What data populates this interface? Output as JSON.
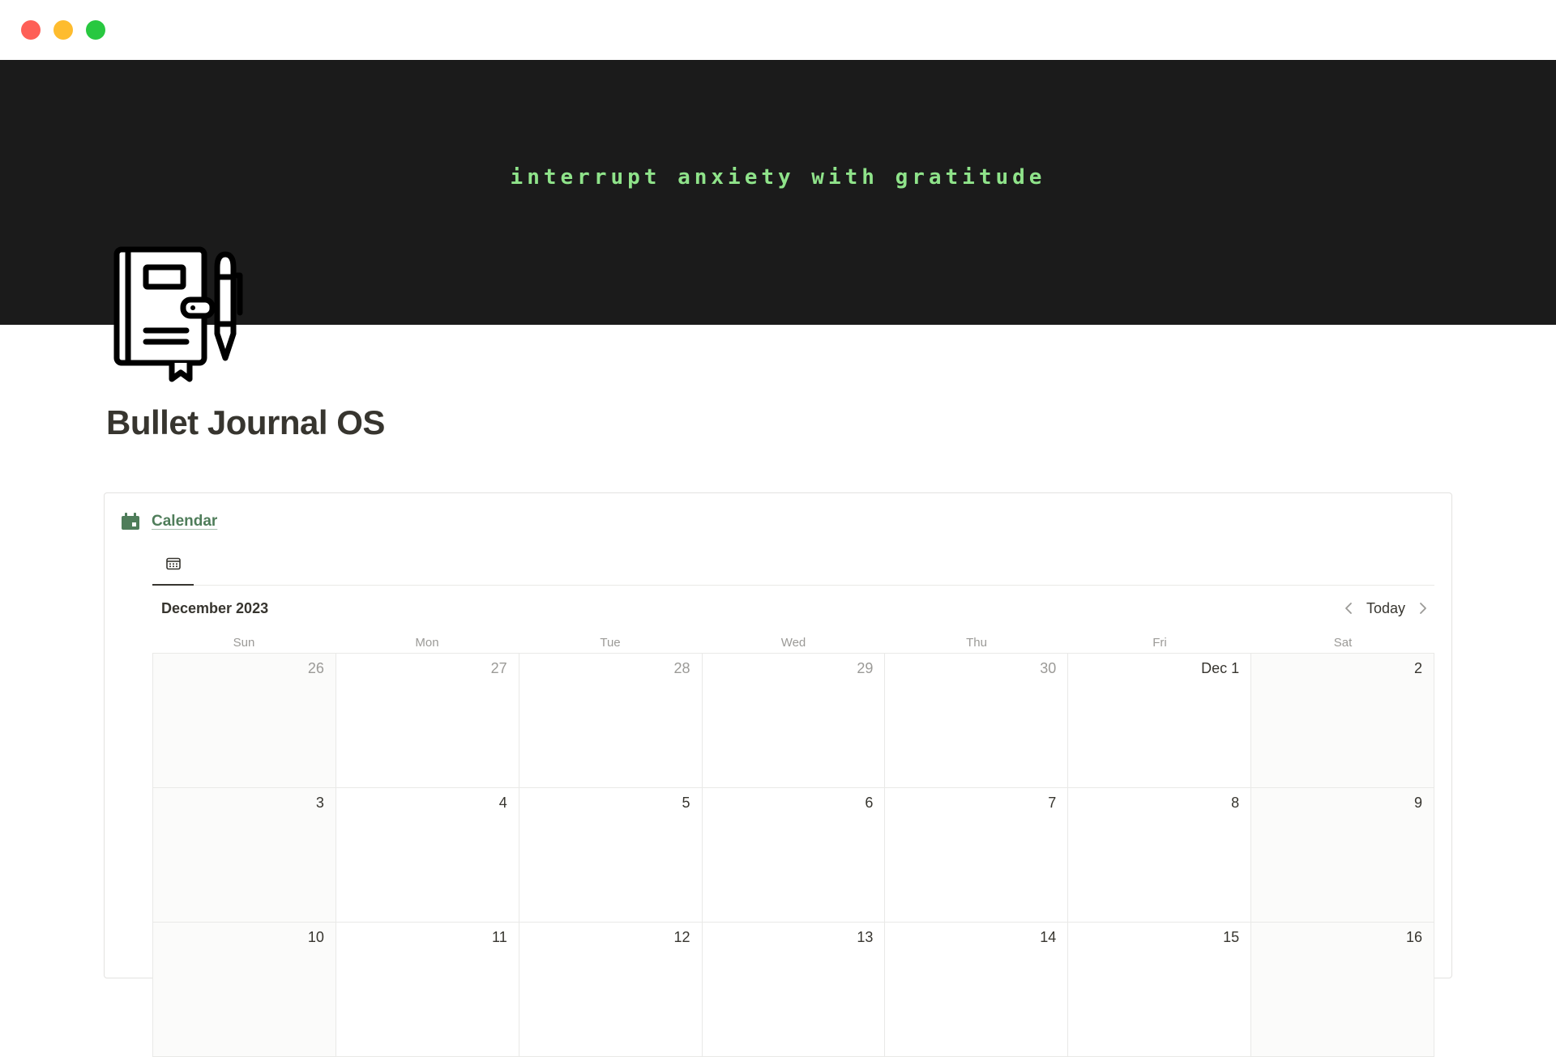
{
  "window": {
    "controls": [
      "close",
      "minimize",
      "maximize"
    ]
  },
  "cover": {
    "text": "interrupt anxiety with gratitude",
    "background_color": "#1b1b1b",
    "text_color": "#8fe38a"
  },
  "page": {
    "icon": "bullet-journal-notebook-pen-icon",
    "title": "Bullet Journal OS"
  },
  "calendar": {
    "db_icon": "calendar-icon",
    "db_title": "Calendar",
    "accent_color": "#4f7d5a",
    "view_tab_icon": "calendar-view-icon",
    "month_label": "December 2023",
    "nav": {
      "prev_icon": "chevron-left-icon",
      "today_label": "Today",
      "next_icon": "chevron-right-icon"
    },
    "weekdays": [
      "Sun",
      "Mon",
      "Tue",
      "Wed",
      "Thu",
      "Fri",
      "Sat"
    ],
    "weeks": [
      [
        {
          "label": "26",
          "muted": true
        },
        {
          "label": "27",
          "muted": true
        },
        {
          "label": "28",
          "muted": true
        },
        {
          "label": "29",
          "muted": true
        },
        {
          "label": "30",
          "muted": true
        },
        {
          "label": "Dec 1",
          "muted": false
        },
        {
          "label": "2",
          "muted": false
        }
      ],
      [
        {
          "label": "3",
          "muted": false
        },
        {
          "label": "4",
          "muted": false
        },
        {
          "label": "5",
          "muted": false
        },
        {
          "label": "6",
          "muted": false
        },
        {
          "label": "7",
          "muted": false
        },
        {
          "label": "8",
          "muted": false
        },
        {
          "label": "9",
          "muted": false
        }
      ],
      [
        {
          "label": "10",
          "muted": false
        },
        {
          "label": "11",
          "muted": false
        },
        {
          "label": "12",
          "muted": false
        },
        {
          "label": "13",
          "muted": false
        },
        {
          "label": "14",
          "muted": false
        },
        {
          "label": "15",
          "muted": false
        },
        {
          "label": "16",
          "muted": false
        }
      ]
    ]
  }
}
